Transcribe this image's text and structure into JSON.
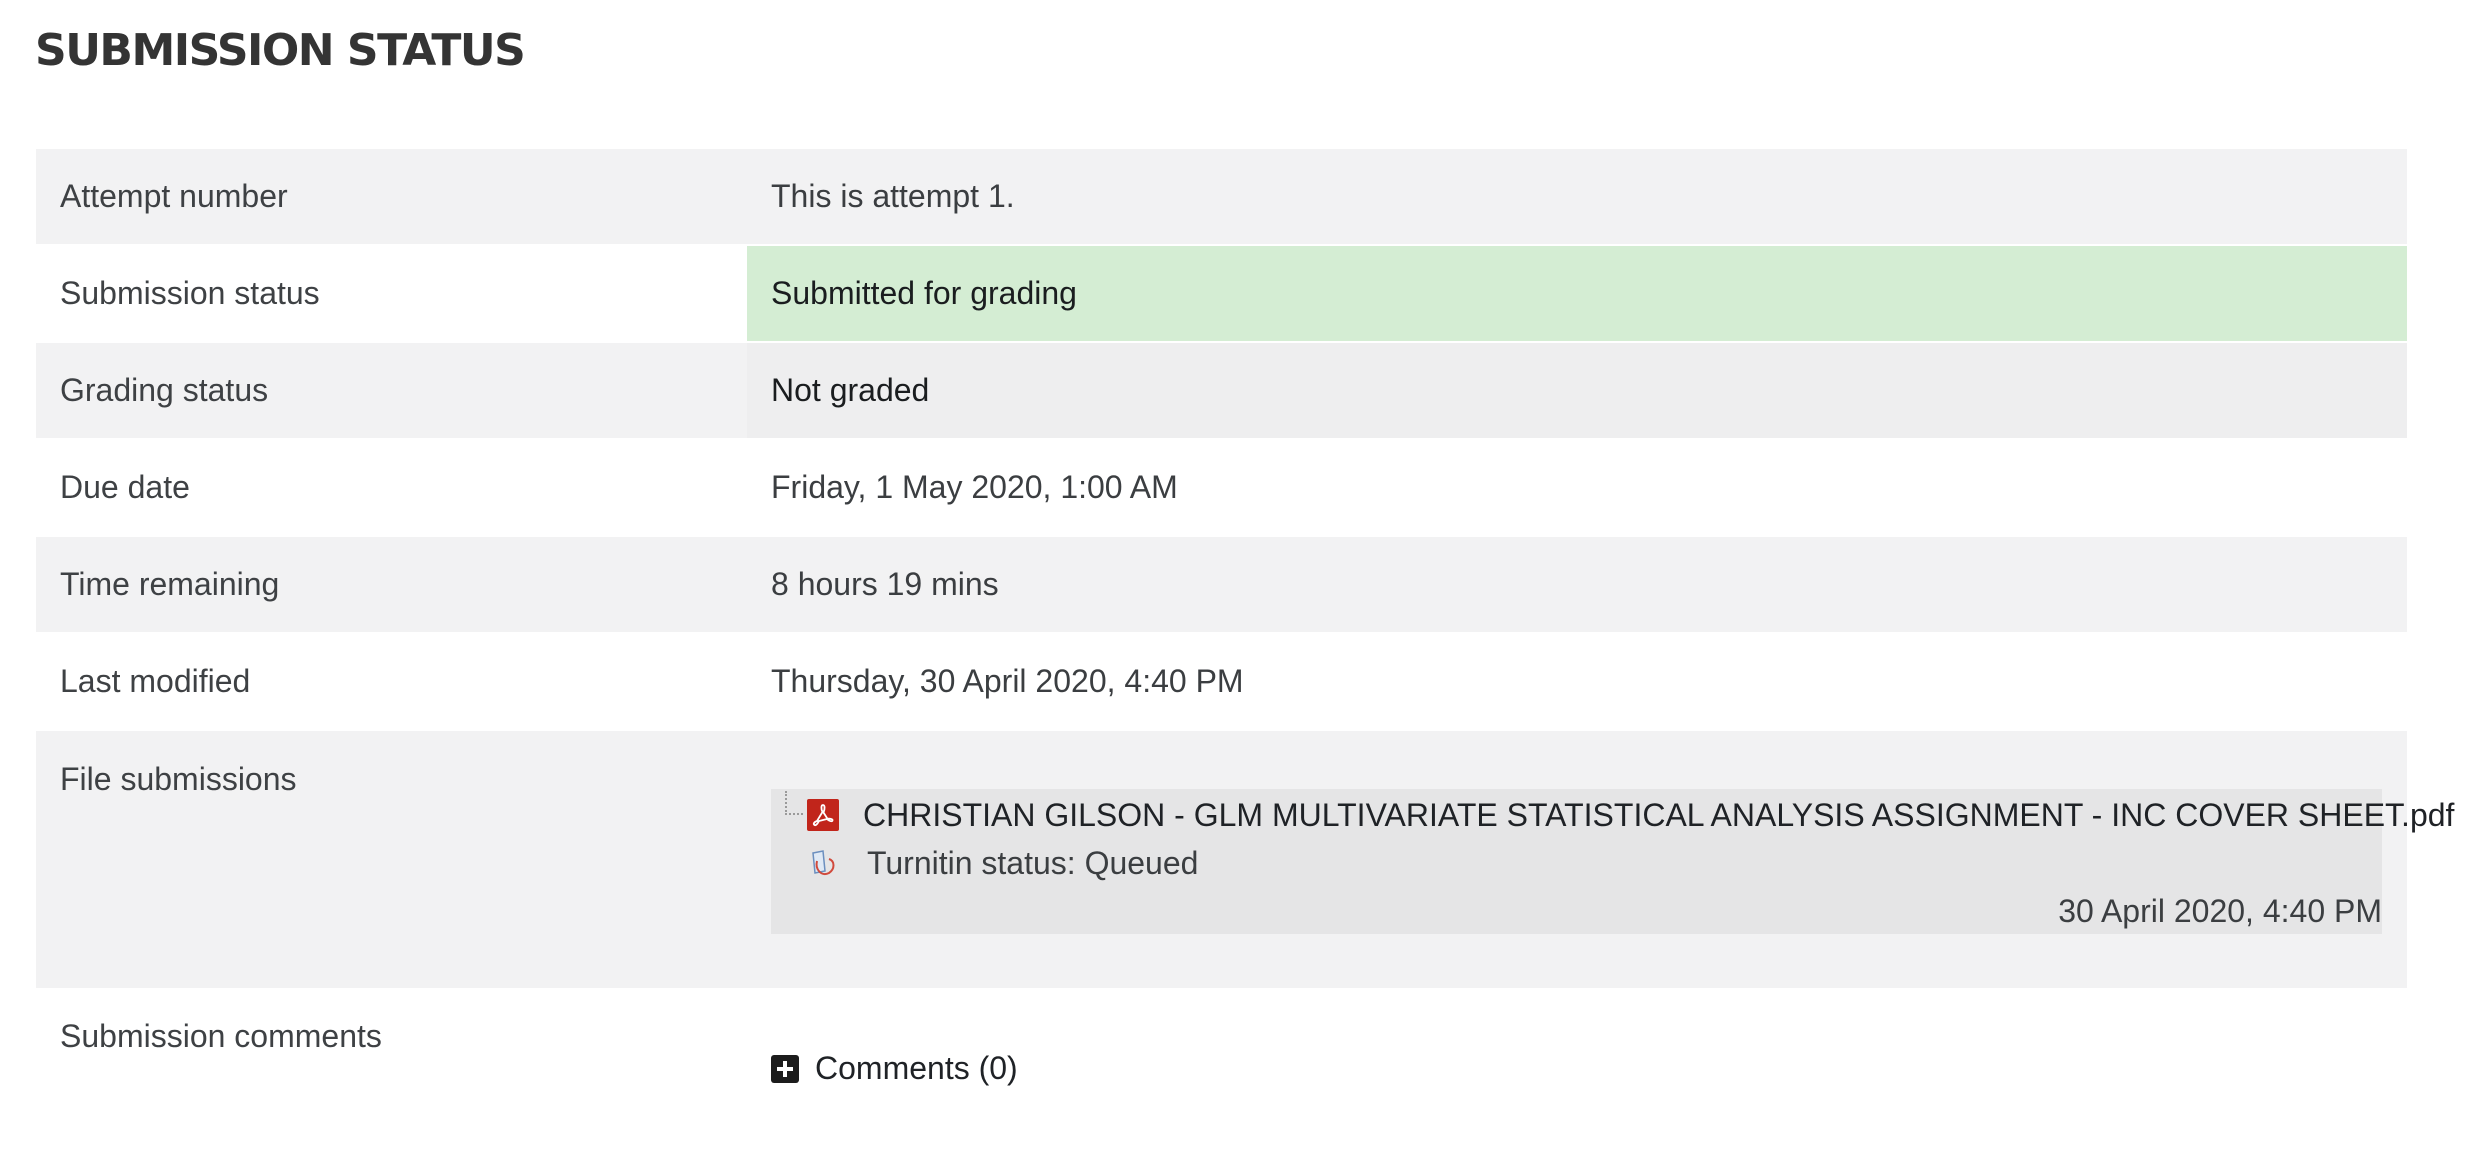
{
  "page": {
    "title": "SUBMISSION STATUS"
  },
  "rows": {
    "attempt": {
      "label": "Attempt number",
      "value": "This is attempt 1."
    },
    "submission_status": {
      "label": "Submission status",
      "value": "Submitted for grading"
    },
    "grading_status": {
      "label": "Grading status",
      "value": "Not graded"
    },
    "due_date": {
      "label": "Due date",
      "value": "Friday, 1 May 2020, 1:00 AM"
    },
    "time_remaining": {
      "label": "Time remaining",
      "value": "8 hours 19 mins"
    },
    "last_modified": {
      "label": "Last modified",
      "value": "Thursday, 30 April 2020, 4:40 PM"
    },
    "file_submissions": {
      "label": "File submissions",
      "file": {
        "name": "CHRISTIAN GILSON - GLM MULTIVARIATE STATISTICAL ANALYSIS ASSIGNMENT - INC COVER SHEET.pdf",
        "icon": "pdf-icon",
        "turnitin_status": "Turnitin status: Queued",
        "turnitin_icon": "turnitin-icon",
        "date": "30 April 2020, 4:40 PM"
      }
    },
    "submission_comments": {
      "label": "Submission comments",
      "toggle_label": "Comments (0)",
      "icon": "plus-square-icon"
    }
  },
  "colors": {
    "row_alt": "#f2f2f3",
    "submitted_bg": "#d4edd3",
    "not_graded_bg": "#eeeeef",
    "file_box_bg": "#e5e5e6",
    "pdf_red": "#c1251b"
  }
}
